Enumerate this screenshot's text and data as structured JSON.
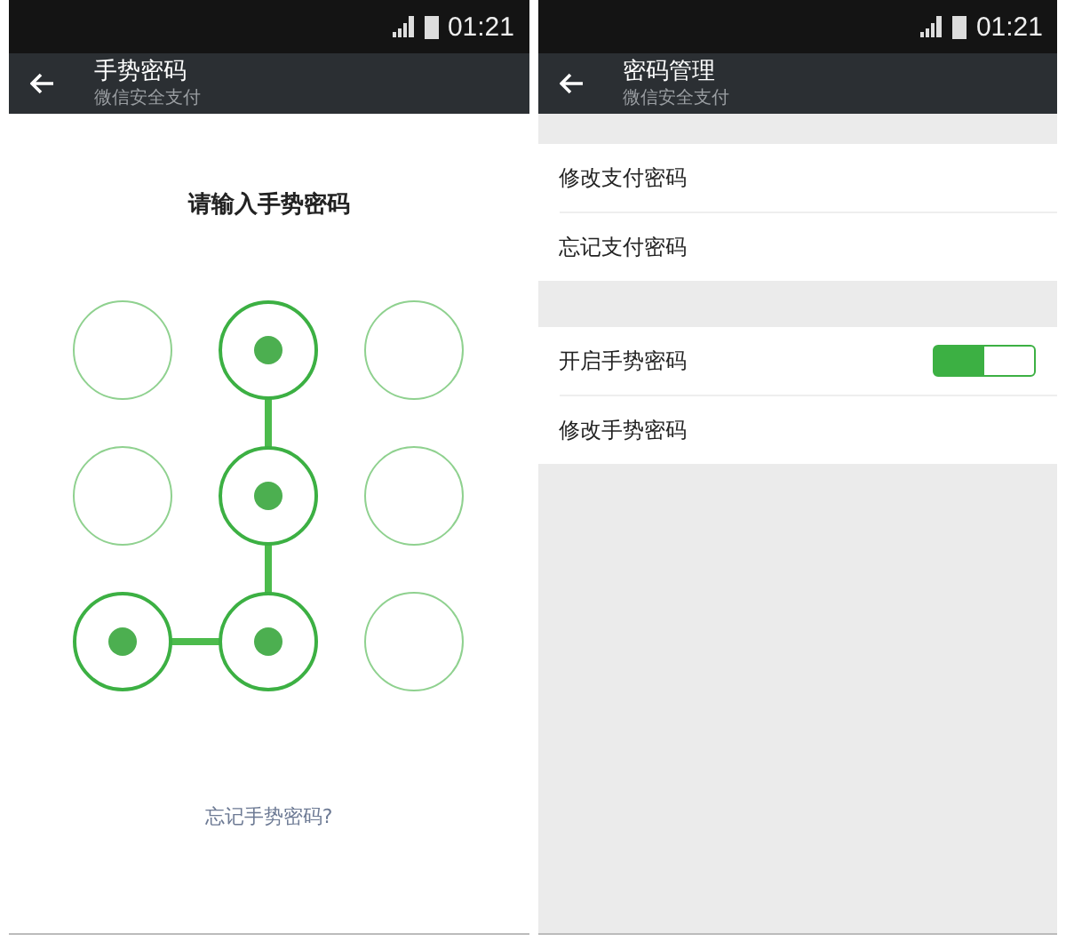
{
  "screens": [
    {
      "kind": "pattern",
      "status_bar": {
        "time": "01:21"
      },
      "app_bar": {
        "title": "手势密码",
        "subtitle": "微信安全支付"
      },
      "prompt": "请输入手势密码",
      "dots": [
        {
          "selected": false,
          "linked_below": false,
          "linked_left": false
        },
        {
          "selected": true,
          "linked_below": true,
          "linked_left": false
        },
        {
          "selected": false,
          "linked_below": false,
          "linked_left": false
        },
        {
          "selected": false,
          "linked_below": false,
          "linked_left": false
        },
        {
          "selected": true,
          "linked_below": true,
          "linked_left": false
        },
        {
          "selected": false,
          "linked_below": false,
          "linked_left": false
        },
        {
          "selected": true,
          "linked_below": false,
          "linked_left": false
        },
        {
          "selected": true,
          "linked_below": false,
          "linked_left": true
        },
        {
          "selected": false,
          "linked_below": false,
          "linked_left": false
        }
      ],
      "link": "忘记手势密码?"
    },
    {
      "kind": "settings",
      "status_bar": {
        "time": "01:21"
      },
      "app_bar": {
        "title": "密码管理",
        "subtitle": "微信安全支付"
      },
      "groups": [
        [
          {
            "kind": "plain",
            "label": "修改支付密码"
          },
          {
            "kind": "plain",
            "label": "忘记支付密码"
          }
        ],
        [
          {
            "kind": "switch",
            "label": "开启手势密码",
            "on": true
          },
          {
            "kind": "plain",
            "label": "修改手势密码"
          }
        ]
      ]
    }
  ]
}
